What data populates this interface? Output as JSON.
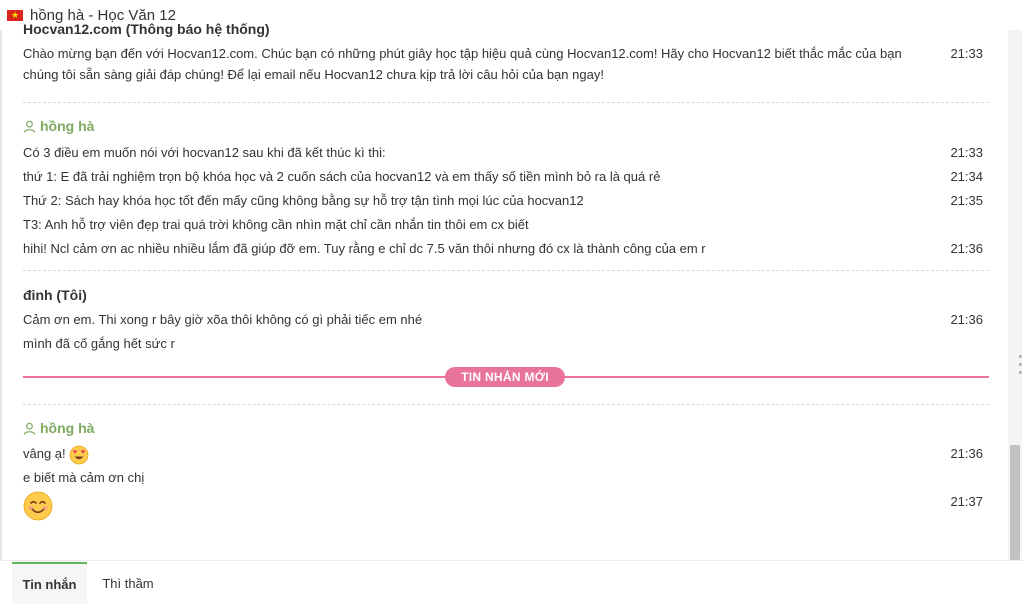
{
  "window": {
    "title": "hồng hà - Học Văn 12",
    "flag_icon": "vietnam-flag-icon"
  },
  "colors": {
    "user_name": "#7eaa60",
    "new_divider": "#e8739c",
    "active_tab_border": "#5cb85c"
  },
  "groups": [
    {
      "sender": "Hocvan12.com (Thông báo hệ thống)",
      "messages": [
        {
          "text": "Chào mừng bạn đến với Hocvan12.com. Chúc bạn có những phút giây học tập hiệu quả cùng Hocvan12.com! Hãy cho Hocvan12 biết thắc mắc của bạn chúng tôi sẵn sàng giải đáp chúng! Để lại email nếu Hocvan12 chưa kịp trả lời câu hỏi của bạn ngay!",
          "time": "21:33"
        }
      ]
    },
    {
      "sender": "hồng hà",
      "messages": [
        {
          "text": "Có 3 điều em muốn nói với hocvan12 sau khi đã kết thúc kì thi:",
          "time": "21:33"
        },
        {
          "text": "thứ 1: E đã trải nghiệm trọn bộ khóa học và 2 cuốn sách của hocvan12 và em thấy số tiền mình bỏ ra là quá rẻ",
          "time": "21:34"
        },
        {
          "text": "Thứ 2: Sách hay khóa học tốt đến mấy cũng không bằng sự hỗ trợ tận tình mọi lúc của hocvan12",
          "time": "21:35"
        },
        {
          "text": "T3: Anh hỗ trợ viên đẹp trai quá trời không cần nhìn mặt chỉ cần nhắn tin thôi em cx biết",
          "time": ""
        },
        {
          "text": "hihi! Ncl cảm ơn ac nhiều nhiều lắm đã giúp đỡ em. Tuy rằng e chỉ dc 7.5 văn thôi nhưng đó cx là thành công của em r",
          "time": "21:36"
        }
      ]
    },
    {
      "sender": "đinh (Tôi)",
      "messages": [
        {
          "text": "Cảm ơn em. Thi xong r bây giờ xõa thôi không có gì phải tiếc em nhé",
          "time": "21:36"
        },
        {
          "text": "mình đã cố gắng hết sức r",
          "time": ""
        }
      ]
    },
    {
      "sender": "hồng hà",
      "messages": [
        {
          "text": "vâng ạ!",
          "time": "21:36",
          "emoji": "heart-eyes-emoji"
        },
        {
          "text": "e biết mà cảm ơn chị",
          "time": ""
        },
        {
          "text": "",
          "time": "21:37",
          "emoji": "smiling-emoji"
        }
      ]
    }
  ],
  "new_messages_label": "TIN NHẮN MỚI",
  "tabs": [
    {
      "label": "Tin nhắn",
      "active": true
    },
    {
      "label": "Thì thầm",
      "active": false
    }
  ]
}
